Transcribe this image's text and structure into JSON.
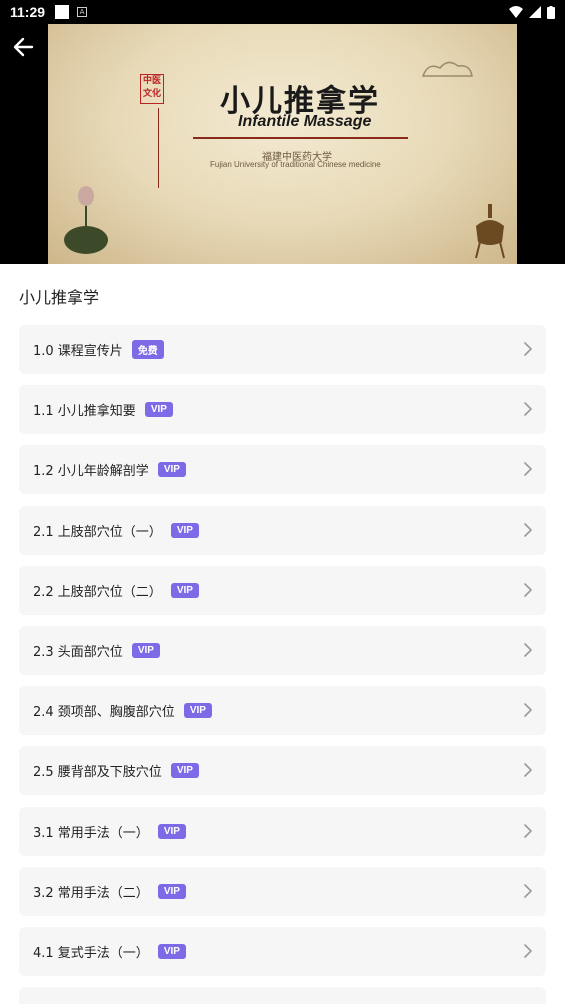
{
  "status_bar": {
    "time": "11:29"
  },
  "video": {
    "title_cn": "小儿推拿学",
    "title_en": "Infantile Massage",
    "university_cn": "福建中医药大学",
    "university_en": "Fujian University of traditional Chinese medicine",
    "seal_text": "中医文化"
  },
  "course": {
    "title": "小儿推拿学"
  },
  "lessons": [
    {
      "label": "1.0 课程宣传片",
      "badge": "免费"
    },
    {
      "label": "1.1 小儿推拿知要",
      "badge": "VIP"
    },
    {
      "label": "1.2 小儿年龄解剖学",
      "badge": "VIP"
    },
    {
      "label": "2.1 上肢部穴位（一）",
      "badge": "VIP"
    },
    {
      "label": "2.2 上肢部穴位（二）",
      "badge": "VIP"
    },
    {
      "label": "2.3 头面部穴位",
      "badge": "VIP"
    },
    {
      "label": "2.4 颈项部、胸腹部穴位",
      "badge": "VIP"
    },
    {
      "label": "2.5 腰背部及下肢穴位",
      "badge": "VIP"
    },
    {
      "label": "3.1 常用手法（一）",
      "badge": "VIP"
    },
    {
      "label": "3.2 常用手法（二）",
      "badge": "VIP"
    },
    {
      "label": "4.1 复式手法（一）",
      "badge": "VIP"
    },
    {
      "label": "",
      "badge": ""
    }
  ],
  "colors": {
    "badge": "#7d6ae6",
    "item_bg": "#f6f6f6"
  }
}
